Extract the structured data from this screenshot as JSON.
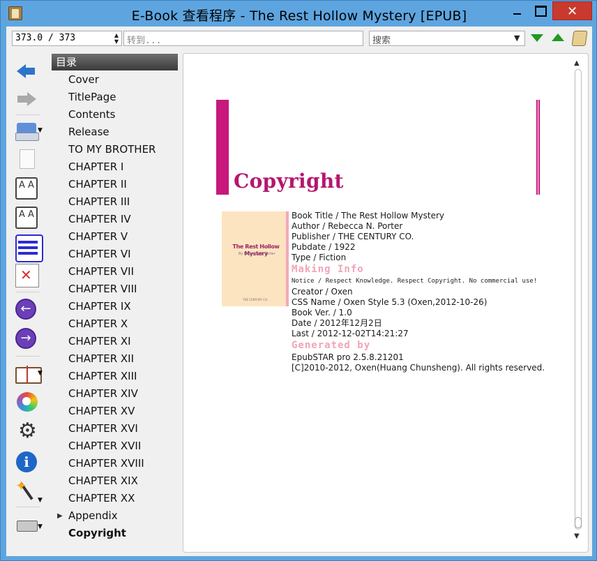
{
  "window": {
    "title": "E-Book 查看程序 - The Rest Hollow Mystery [EPUB]",
    "close_glyph": "✕"
  },
  "toolbar": {
    "page_value": "373.0 / 373",
    "goto_placeholder": "转到...",
    "search_placeholder": "搜索"
  },
  "toc": {
    "header": "目录",
    "items": [
      {
        "label": "Cover"
      },
      {
        "label": "TitlePage"
      },
      {
        "label": "Contents"
      },
      {
        "label": "Release"
      },
      {
        "label": "TO MY BROTHER"
      },
      {
        "label": "CHAPTER I"
      },
      {
        "label": "CHAPTER II"
      },
      {
        "label": "CHAPTER III"
      },
      {
        "label": "CHAPTER IV"
      },
      {
        "label": "CHAPTER V"
      },
      {
        "label": "CHAPTER VI"
      },
      {
        "label": "CHAPTER VII"
      },
      {
        "label": "CHAPTER VIII"
      },
      {
        "label": "CHAPTER IX"
      },
      {
        "label": "CHAPTER X"
      },
      {
        "label": "CHAPTER XI"
      },
      {
        "label": "CHAPTER XII"
      },
      {
        "label": "CHAPTER XIII"
      },
      {
        "label": "CHAPTER XIV"
      },
      {
        "label": "CHAPTER XV"
      },
      {
        "label": "CHAPTER XVI"
      },
      {
        "label": "CHAPTER XVII"
      },
      {
        "label": "CHAPTER XVIII"
      },
      {
        "label": "CHAPTER XIX"
      },
      {
        "label": "CHAPTER XX"
      },
      {
        "label": "Appendix",
        "expandable": true
      },
      {
        "label": "Copyright",
        "active": true
      }
    ]
  },
  "page": {
    "chapter_title": "Copyright",
    "cover": {
      "title": "The Rest Hollow Mystery",
      "author": "By Rebecca N. Porter",
      "publisher": "THE CENTURY CO."
    },
    "info_lines_1": [
      "Book Title / The Rest Hollow Mystery",
      "Author / Rebecca N. Porter",
      "Publisher / THE CENTURY CO.",
      "Pubdate / 1922",
      "Type / Fiction"
    ],
    "making_info_heading": "Making Info",
    "notice": "Notice / Respect Knowledge. Respect Copyright. No commercial use!",
    "info_lines_2": [
      "Creator / Oxen",
      "CSS Name / Oxen Style 5.3 (Oxen,2012-10-26)",
      "Book Ver. / 1.0",
      "Date / 2012年12月2日",
      "Last / 2012-12-02T14:21:27"
    ],
    "generated_heading": "Generated by",
    "info_lines_3": [
      "EpubSTAR pro 2.5.8.21201",
      "[C]2010-2012, Oxen(Huang Chunsheng). All rights reserved."
    ]
  },
  "icons": {
    "font_larger_text": "A A",
    "font_smaller_text": "A A",
    "nav_prev_glyph": "←",
    "nav_next_glyph": "→"
  },
  "colors": {
    "accent_magenta": "#c6187d",
    "heading_pink": "#f2a4b7",
    "title_bar_blue": "#5ea5e0",
    "find_arrow_green": "#1f9a22"
  }
}
